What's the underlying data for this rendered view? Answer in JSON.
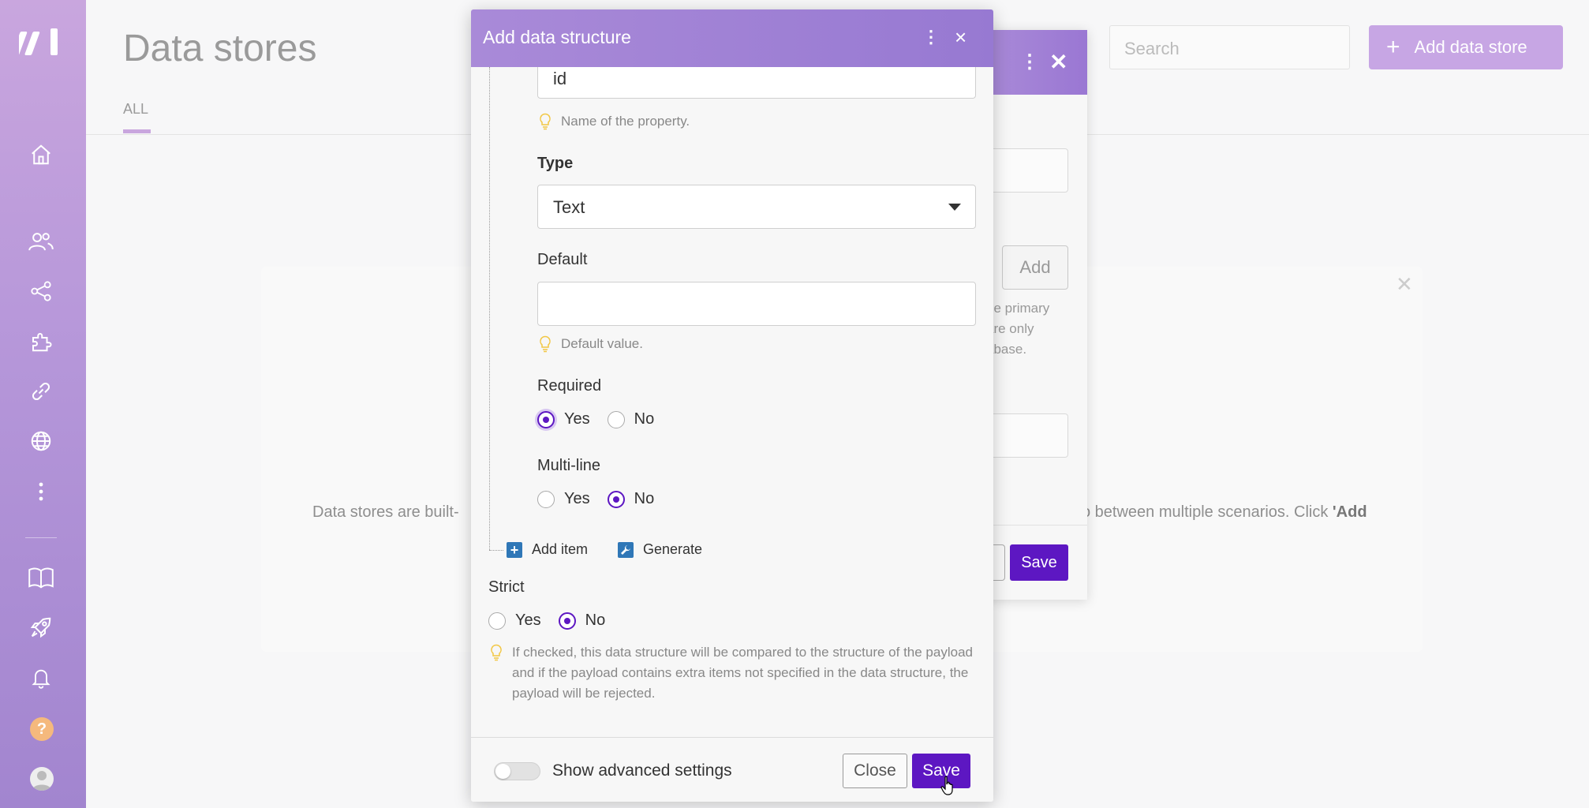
{
  "page": {
    "title": "Data stores",
    "tab_all": "ALL",
    "search_placeholder": "Search",
    "add_button": "Add data store",
    "empty_text_left": "Data stores are built-",
    "empty_text_right": "o between multiple scenarios. Click ",
    "empty_text_right_bold": "'Add"
  },
  "back_modal": {
    "add_label": "Add",
    "note_lines": [
      "he primary",
      "are only",
      "abase."
    ],
    "save_label": "Save"
  },
  "modal": {
    "title": "Add data structure",
    "name_value": "id",
    "name_hint": "Name of the property.",
    "type_label": "Type",
    "type_value": "Text",
    "default_label": "Default",
    "default_value": "",
    "default_hint": "Default value.",
    "required": {
      "label": "Required",
      "options": [
        "Yes",
        "No"
      ],
      "selected": "Yes"
    },
    "multiline": {
      "label": "Multi-line",
      "options": [
        "Yes",
        "No"
      ],
      "selected": "No"
    },
    "add_item_label": "Add item",
    "generate_label": "Generate",
    "strict": {
      "label": "Strict",
      "options": [
        "Yes",
        "No"
      ],
      "selected": "No",
      "hint": "If checked, this data structure will be compared to the structure of the payload and if the payload contains extra items not specified in the data structure, the payload will be rejected."
    },
    "footer": {
      "advanced_label": "Show advanced settings",
      "advanced_on": false,
      "close_label": "Close",
      "save_label": "Save"
    }
  },
  "colors": {
    "sidebar_top": "#c9a6de",
    "accent": "#5d17c2",
    "header": "#a98ad8"
  }
}
